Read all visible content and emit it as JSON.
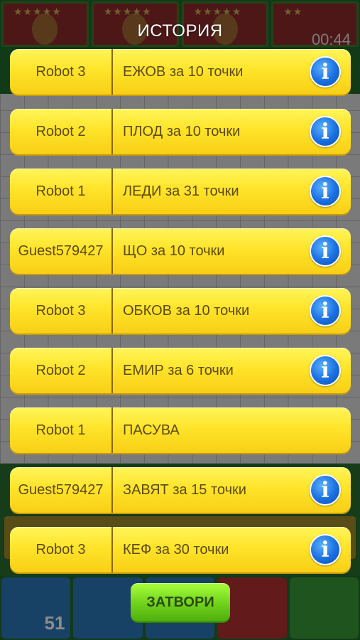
{
  "modal": {
    "title": "ИСТОРИЯ",
    "close_label": "ЗАТВОРИ"
  },
  "history": [
    {
      "player": "Robot 3",
      "move": "ЕЖОВ за 10 точки",
      "has_info": true
    },
    {
      "player": "Robot 2",
      "move": "ПЛОД за 10 точки",
      "has_info": true
    },
    {
      "player": "Robot 1",
      "move": "ЛЕДИ за 31 точки",
      "has_info": true
    },
    {
      "player": "Guest579427",
      "move": "ЩО за 10 точки",
      "has_info": true
    },
    {
      "player": "Robot 3",
      "move": "ОБКОВ за 10 точки",
      "has_info": true
    },
    {
      "player": "Robot 2",
      "move": "ЕМИР за 6 точки",
      "has_info": true
    },
    {
      "player": "Robot 1",
      "move": "ПАСУВА",
      "has_info": false
    },
    {
      "player": "Guest579427",
      "move": "ЗАВЯТ за 15 точки",
      "has_info": true
    },
    {
      "player": "Robot 3",
      "move": "КЕФ за 30 точки",
      "has_info": true
    }
  ],
  "background": {
    "timer": "00:44",
    "chest_count": "51",
    "player_stars": [
      "★★★★★",
      "★★★★★",
      "★★★★★",
      "★★"
    ]
  },
  "icons": {
    "info": "info-icon",
    "chest": "treasure-chest-icon",
    "book": "dictionary-book-icon",
    "reject": "x-icon",
    "accept": "checkmark-icon"
  },
  "colors": {
    "row_yellow": "#ffe42a",
    "info_blue": "#1a6fe0",
    "close_green": "#6fd11a"
  }
}
